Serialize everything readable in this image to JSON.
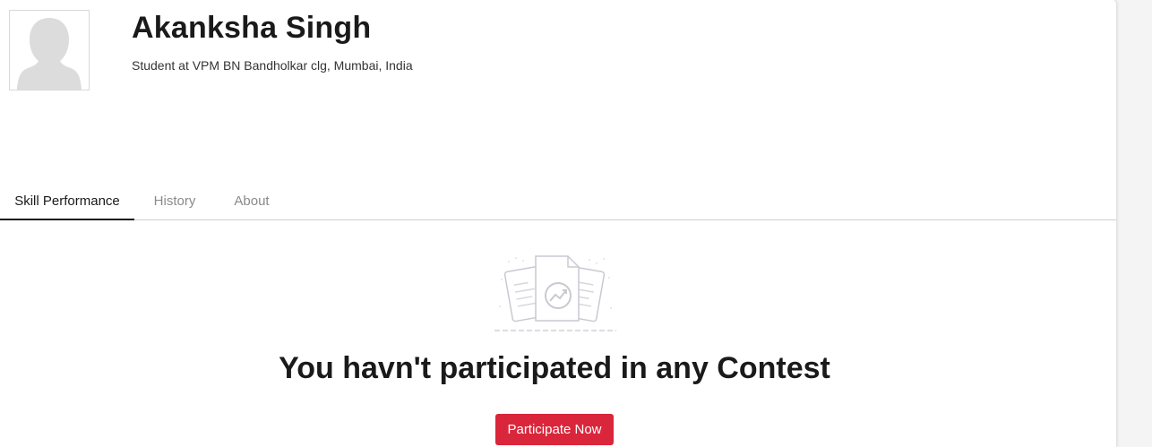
{
  "profile": {
    "name": "Akanksha Singh",
    "headline": "Student at VPM BN Bandholkar clg, Mumbai, India",
    "avatar_icon": "default-user-silhouette-icon"
  },
  "tabs": [
    {
      "label": "Skill Performance",
      "active": true
    },
    {
      "label": "History",
      "active": false
    },
    {
      "label": "About",
      "active": false
    }
  ],
  "empty_state": {
    "illustration_icon": "documents-chart-icon",
    "title": "You havn't participated in any Contest",
    "cta_label": "Participate Now"
  },
  "colors": {
    "accent": "#d9263b",
    "active_tab": "#1a1a1a",
    "inactive_tab": "#8a8a8a"
  }
}
